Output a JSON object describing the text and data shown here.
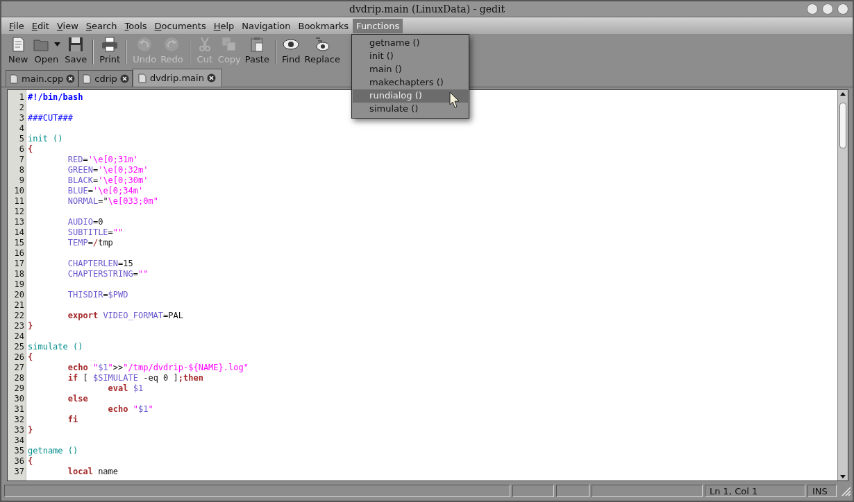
{
  "window": {
    "title": "dvdrip.main  (LinuxData) - gedit"
  },
  "menu_bar": [
    {
      "label": "File",
      "mnemonic": true,
      "selected": false
    },
    {
      "label": "Edit",
      "mnemonic": true,
      "selected": false
    },
    {
      "label": "View",
      "mnemonic": true,
      "selected": false
    },
    {
      "label": "Search",
      "mnemonic": true,
      "selected": false
    },
    {
      "label": "Tools",
      "mnemonic": true,
      "selected": false
    },
    {
      "label": "Documents",
      "mnemonic": true,
      "selected": false
    },
    {
      "label": "Help",
      "mnemonic": true,
      "selected": false
    },
    {
      "label": "Navigation",
      "mnemonic": false,
      "selected": false
    },
    {
      "label": "Bookmarks",
      "mnemonic": false,
      "selected": false
    },
    {
      "label": "Functions",
      "mnemonic": false,
      "selected": true
    }
  ],
  "functions_menu": [
    {
      "label": "getname ()",
      "selected": false
    },
    {
      "label": "init ()",
      "selected": false
    },
    {
      "label": "main ()",
      "selected": false
    },
    {
      "label": "makechapters ()",
      "selected": false
    },
    {
      "label": "rundialog ()",
      "selected": true
    },
    {
      "label": "simulate ()",
      "selected": false
    }
  ],
  "toolbar": [
    {
      "label": "New",
      "disabled": false,
      "separator_before": false,
      "dropdown": false
    },
    {
      "label": "Open",
      "disabled": false,
      "separator_before": false,
      "dropdown": true
    },
    {
      "label": "Save",
      "disabled": false,
      "separator_before": false,
      "dropdown": false
    },
    {
      "label": "Print",
      "disabled": false,
      "separator_before": true,
      "dropdown": false
    },
    {
      "label": "Undo",
      "disabled": true,
      "separator_before": true,
      "dropdown": false
    },
    {
      "label": "Redo",
      "disabled": true,
      "separator_before": false,
      "dropdown": false
    },
    {
      "label": "Cut",
      "disabled": true,
      "separator_before": true,
      "dropdown": false
    },
    {
      "label": "Copy",
      "disabled": true,
      "separator_before": false,
      "dropdown": false
    },
    {
      "label": "Paste",
      "disabled": false,
      "separator_before": false,
      "dropdown": false
    },
    {
      "label": "Find",
      "disabled": false,
      "separator_before": true,
      "dropdown": false
    },
    {
      "label": "Replace",
      "disabled": false,
      "separator_before": false,
      "dropdown": false
    }
  ],
  "tabs": [
    {
      "label": "main.cpp",
      "selected": false
    },
    {
      "label": "cdrip",
      "selected": false
    },
    {
      "label": "dvdrip.main",
      "selected": true
    }
  ],
  "editor": {
    "lines": [
      {
        "number": "1",
        "tokens": [
          {
            "kind": "shebang",
            "text": "#!/bin/bash"
          }
        ]
      },
      {
        "number": "2"
      },
      {
        "number": "3",
        "tokens": [
          {
            "kind": "comment",
            "text": "###CUT###"
          }
        ]
      },
      {
        "number": "4"
      },
      {
        "number": "5",
        "tokens": [
          {
            "kind": "func",
            "text": "init ()"
          }
        ]
      },
      {
        "number": "6",
        "tokens": [
          {
            "kind": "brace",
            "text": "{"
          }
        ]
      },
      {
        "number": "7",
        "tokens": [
          {
            "kind": "var",
            "text": "\tRED"
          },
          {
            "kind": "plain",
            "text": "="
          },
          {
            "kind": "str",
            "text": "'\\e[0;31m'"
          }
        ]
      },
      {
        "number": "8",
        "tokens": [
          {
            "kind": "var",
            "text": "\tGREEN"
          },
          {
            "kind": "plain",
            "text": "="
          },
          {
            "kind": "str",
            "text": "'\\e[0;32m'"
          }
        ]
      },
      {
        "number": "9",
        "tokens": [
          {
            "kind": "var",
            "text": "\tBLACK"
          },
          {
            "kind": "plain",
            "text": "="
          },
          {
            "kind": "str",
            "text": "'\\e[0;30m'"
          }
        ]
      },
      {
        "number": "10",
        "tokens": [
          {
            "kind": "var",
            "text": "\tBLUE"
          },
          {
            "kind": "plain",
            "text": "="
          },
          {
            "kind": "str",
            "text": "'\\e[0;34m'"
          }
        ]
      },
      {
        "number": "11",
        "tokens": [
          {
            "kind": "var",
            "text": "\tNORMAL"
          },
          {
            "kind": "plain",
            "text": "=\""
          },
          {
            "kind": "str",
            "text": "\\e[033;0m\""
          }
        ]
      },
      {
        "number": "12"
      },
      {
        "number": "13",
        "tokens": [
          {
            "kind": "var",
            "text": "\tAUDIO"
          },
          {
            "kind": "plain",
            "text": "=0"
          }
        ]
      },
      {
        "number": "14",
        "tokens": [
          {
            "kind": "var",
            "text": "\tSUBTITLE"
          },
          {
            "kind": "plain",
            "text": "="
          },
          {
            "kind": "str",
            "text": "\"\""
          }
        ]
      },
      {
        "number": "15",
        "tokens": [
          {
            "kind": "var",
            "text": "\tTEMP"
          },
          {
            "kind": "plain",
            "text": "="
          },
          {
            "kind": "op",
            "text": "/"
          },
          {
            "kind": "plain",
            "text": "tmp"
          }
        ]
      },
      {
        "number": "16"
      },
      {
        "number": "17",
        "tokens": [
          {
            "kind": "var",
            "text": "\tCHAPTERLEN"
          },
          {
            "kind": "plain",
            "text": "=15"
          }
        ]
      },
      {
        "number": "18",
        "tokens": [
          {
            "kind": "var",
            "text": "\tCHAPTERSTRING"
          },
          {
            "kind": "plain",
            "text": "="
          },
          {
            "kind": "str",
            "text": "\"\""
          }
        ]
      },
      {
        "number": "19"
      },
      {
        "number": "20",
        "tokens": [
          {
            "kind": "var",
            "text": "\tTHISDIR"
          },
          {
            "kind": "plain",
            "text": "="
          },
          {
            "kind": "var",
            "text": "$PWD"
          }
        ]
      },
      {
        "number": "21"
      },
      {
        "number": "22",
        "tokens": [
          {
            "kind": "kw",
            "text": "\texport "
          },
          {
            "kind": "var",
            "text": "VIDEO_FORMAT"
          },
          {
            "kind": "plain",
            "text": "=PAL"
          }
        ]
      },
      {
        "number": "23",
        "tokens": [
          {
            "kind": "brace",
            "text": "}"
          }
        ]
      },
      {
        "number": "24"
      },
      {
        "number": "25",
        "tokens": [
          {
            "kind": "func",
            "text": "simulate ()"
          }
        ]
      },
      {
        "number": "26",
        "tokens": [
          {
            "kind": "brace",
            "text": "{"
          }
        ]
      },
      {
        "number": "27",
        "tokens": [
          {
            "kind": "kw",
            "text": "\techo "
          },
          {
            "kind": "str",
            "text": "\""
          },
          {
            "kind": "var",
            "text": "$1"
          },
          {
            "kind": "str",
            "text": "\""
          },
          {
            "kind": "plain",
            "text": ">>"
          },
          {
            "kind": "str",
            "text": "\"/tmp/dvdrip-${NAME}.log\""
          }
        ]
      },
      {
        "number": "28",
        "tokens": [
          {
            "kind": "kw",
            "text": "\tif"
          },
          {
            "kind": "plain",
            "text": " [ "
          },
          {
            "kind": "var",
            "text": "$SIMULATE"
          },
          {
            "kind": "plain",
            "text": " -eq 0 ]"
          },
          {
            "kind": "kw",
            "text": ";then"
          }
        ]
      },
      {
        "number": "29",
        "tokens": [
          {
            "kind": "kw",
            "text": "\t\teval "
          },
          {
            "kind": "var",
            "text": "$1"
          }
        ]
      },
      {
        "number": "30",
        "tokens": [
          {
            "kind": "kw",
            "text": "\telse"
          }
        ]
      },
      {
        "number": "31",
        "tokens": [
          {
            "kind": "kw",
            "text": "\t\techo "
          },
          {
            "kind": "str",
            "text": "\""
          },
          {
            "kind": "var",
            "text": "$1"
          },
          {
            "kind": "str",
            "text": "\""
          }
        ]
      },
      {
        "number": "32",
        "tokens": [
          {
            "kind": "kw",
            "text": "\tfi"
          }
        ]
      },
      {
        "number": "33",
        "tokens": [
          {
            "kind": "brace",
            "text": "}"
          }
        ]
      },
      {
        "number": "34"
      },
      {
        "number": "35",
        "tokens": [
          {
            "kind": "func",
            "text": "getname ()"
          }
        ]
      },
      {
        "number": "36",
        "tokens": [
          {
            "kind": "brace",
            "text": "{"
          }
        ]
      },
      {
        "number": "37",
        "tokens": [
          {
            "kind": "kw",
            "text": "\tlocal"
          },
          {
            "kind": "plain",
            "text": " name"
          }
        ]
      }
    ]
  },
  "status_bar": {
    "position": "Ln 1, Col 1",
    "mode": "INS"
  }
}
